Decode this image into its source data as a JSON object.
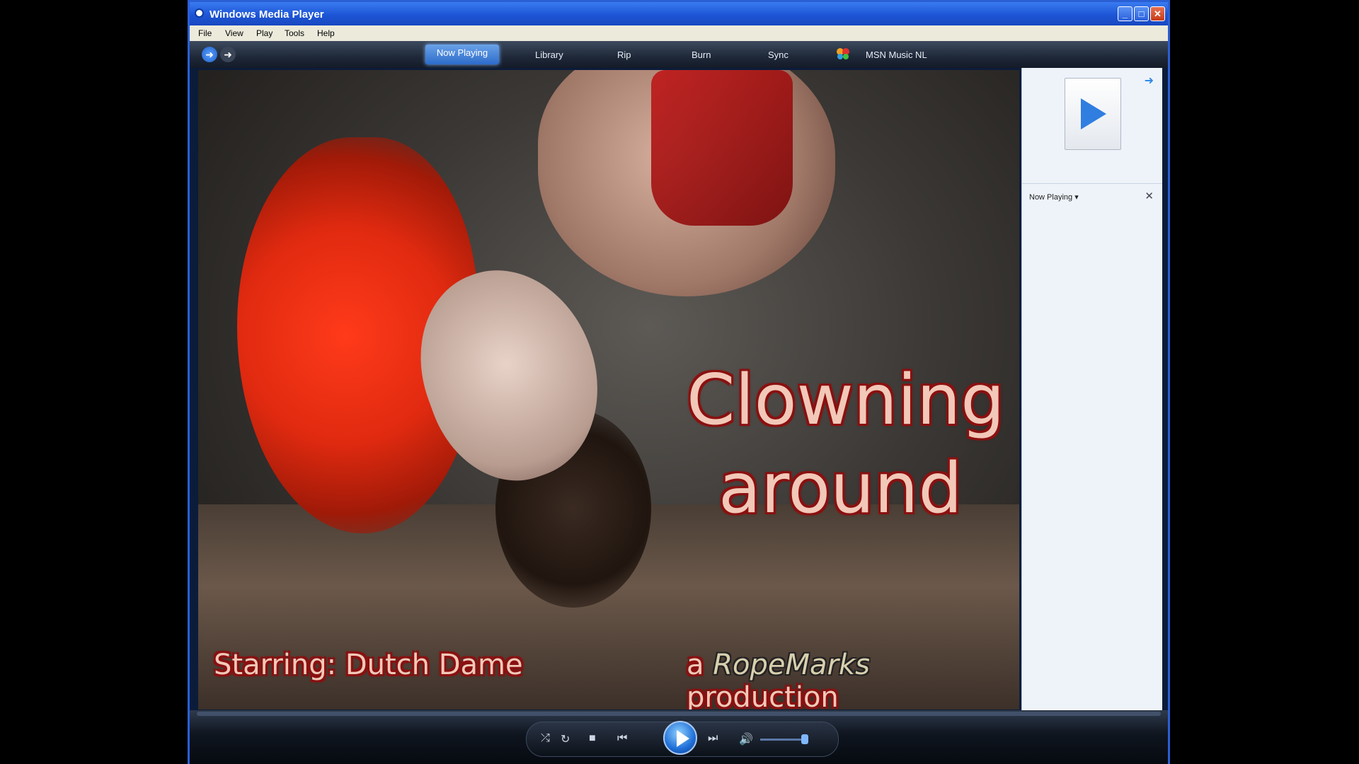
{
  "window": {
    "title": "Windows Media Player"
  },
  "menu": {
    "file": "File",
    "view": "View",
    "play": "Play",
    "tools": "Tools",
    "help": "Help"
  },
  "nav": {
    "tabs": {
      "now_playing": "Now Playing",
      "library": "Library",
      "rip": "Rip",
      "burn": "Burn",
      "sync": "Sync",
      "msn": "MSN Music NL"
    },
    "active_tab": "Now Playing"
  },
  "video": {
    "title_line1": "Clowning",
    "title_line2": "around",
    "starring": "Starring: Dutch Dame",
    "production_prefix": "a ",
    "production_brand": "RopeMarks",
    "production_suffix": " production"
  },
  "sidepanel": {
    "list_label": "Now Playing"
  },
  "icons": {
    "back": "back-arrow-icon",
    "forward": "forward-arrow-icon",
    "shuffle": "shuffle-icon",
    "repeat": "repeat-icon",
    "stop": "stop-icon",
    "previous": "previous-icon",
    "play": "play-icon",
    "next": "next-icon",
    "mute": "speaker-icon",
    "minimize": "minimize-icon",
    "maximize": "maximize-icon",
    "close": "close-icon"
  },
  "colors": {
    "accent": "#2a5fd4",
    "title_text": "#f2c8b8",
    "title_outline": "#8a1010"
  }
}
